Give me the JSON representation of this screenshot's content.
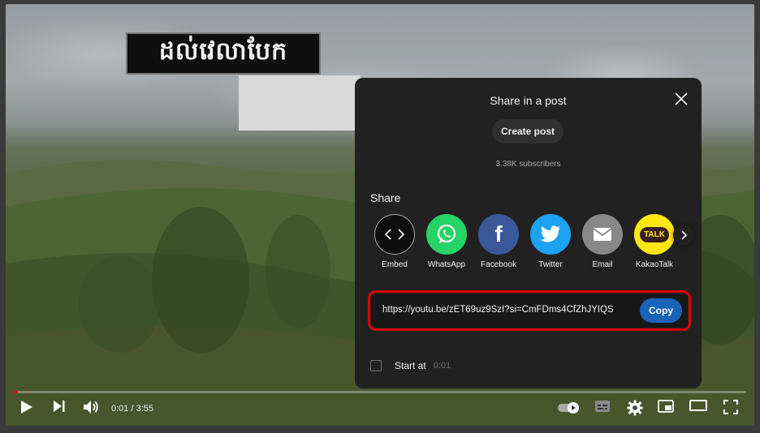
{
  "video": {
    "overlay_title": "ដល់វេលាបែក"
  },
  "dialog": {
    "title": "Share in a post",
    "create_post_label": "Create post",
    "subscribers": "3.38K subscribers",
    "share_heading": "Share",
    "targets": [
      {
        "label": "Embed",
        "icon": "embed-icon",
        "color": "#0f0f0f"
      },
      {
        "label": "WhatsApp",
        "icon": "whatsapp-icon",
        "color": "#25d366"
      },
      {
        "label": "Facebook",
        "icon": "facebook-icon",
        "color": "#3b5998"
      },
      {
        "label": "Twitter",
        "icon": "twitter-icon",
        "color": "#1da1f2"
      },
      {
        "label": "Email",
        "icon": "email-icon",
        "color": "#888888"
      },
      {
        "label": "KakaoTalk",
        "icon": "kakaotalk-icon",
        "color": "#ffe812"
      }
    ],
    "kakao_badge": "TALK",
    "url": "https://youtu.be/zET69uz9SzI?si=CmFDms4CfZhJYIQS",
    "copy_label": "Copy",
    "start_at_label": "Start at",
    "start_at_value": "0:01"
  },
  "player": {
    "time": "0:01 / 3:55",
    "progress_fraction": 0.004,
    "accent": "#ff0000"
  }
}
